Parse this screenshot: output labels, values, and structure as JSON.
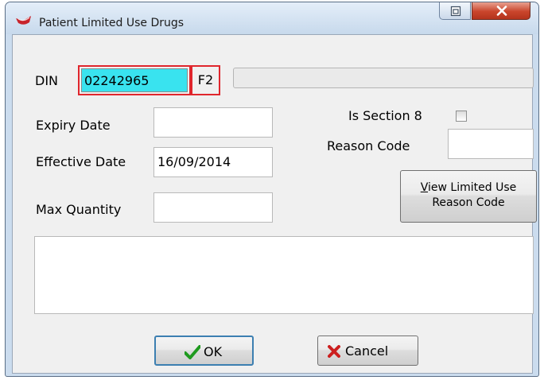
{
  "window": {
    "title": "Patient Limited Use Drugs"
  },
  "form": {
    "din_label": "DIN",
    "din_value": "02242965",
    "f2_label": "F2",
    "expiry_label": "Expiry Date",
    "expiry_value": "",
    "effective_label": "Effective Date",
    "effective_value": "16/09/2014",
    "max_qty_label": "Max Quantity",
    "max_qty_value": "",
    "section8_label": "Is Section 8",
    "section8_checked": false,
    "reason_code_label": "Reason Code",
    "reason_code_value": ""
  },
  "buttons": {
    "view_line1": "View Limited Use",
    "view_line2": "Reason Code",
    "ok": "OK",
    "cancel": "Cancel"
  },
  "icons": {
    "app": "red-pill-icon",
    "ok": "green-check-icon",
    "cancel": "red-x-icon"
  },
  "colors": {
    "din_highlight": "#39e3ef",
    "focus_outline": "#e0262d",
    "close_button": "#c9452c"
  }
}
